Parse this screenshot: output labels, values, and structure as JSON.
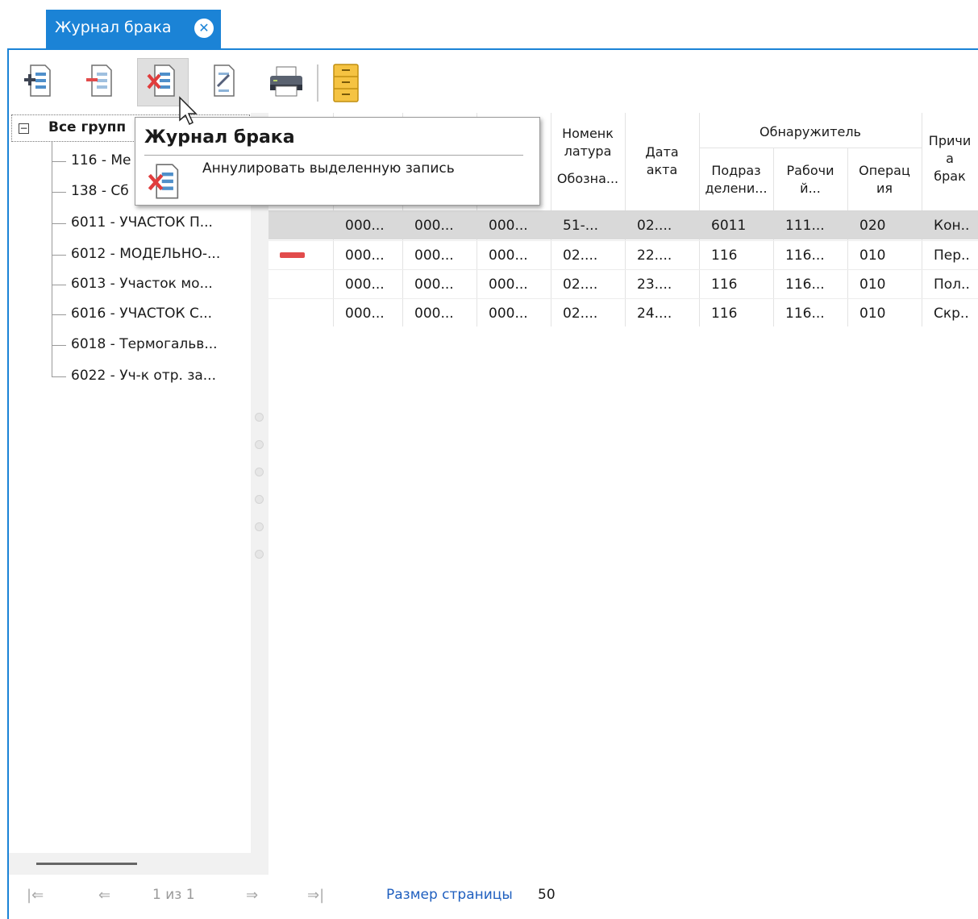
{
  "tab": {
    "title": "Журнал брака",
    "close_glyph": "✕"
  },
  "toolbar": {
    "buttons": [
      {
        "name": "add-record-icon"
      },
      {
        "name": "remove-record-icon"
      },
      {
        "name": "annul-record-icon",
        "pressed": true
      },
      {
        "name": "edit-record-icon"
      },
      {
        "name": "print-icon"
      },
      {
        "name": "archive-cabinet-icon"
      }
    ]
  },
  "tree": {
    "root_label": "Все групп",
    "expander": "−",
    "items": [
      {
        "label": "116 - Ме"
      },
      {
        "label": "138 - Сб"
      },
      {
        "label": "6011 - УЧАСТОК П..."
      },
      {
        "label": "6012 - МОДЕЛЬНО-..."
      },
      {
        "label": "6013 - Участок мо..."
      },
      {
        "label": "6016 - УЧАСТОК С..."
      },
      {
        "label": "6018 - Термогальв..."
      },
      {
        "label": "6022 - Уч-к отр. за..."
      }
    ]
  },
  "grid": {
    "headers": {
      "nomenclature_top": "Номенк",
      "nomenclature_mid": "латура",
      "nomenclature_bottom": "Обозна...",
      "date_top": "Дата",
      "date_bottom": "акта",
      "detector_group": "Обнаружитель",
      "dept_top": "Подраз",
      "dept_bottom": "делени...",
      "worker_top": "Рабочи",
      "worker_bottom": "й...",
      "operation_top": "Операц",
      "operation_bottom": "ия",
      "reason_top": "Причи",
      "reason_mid": "а",
      "reason_bottom": "брак"
    },
    "rows": [
      {
        "c1": "000...",
        "c2": "000...",
        "c3": "000...",
        "nomen": "51-...",
        "date": "02....",
        "dept": "6011",
        "worker": "111...",
        "op": "020",
        "reason": "Кон..",
        "marker": false
      },
      {
        "c1": "000...",
        "c2": "000...",
        "c3": "000...",
        "nomen": "02....",
        "date": "22....",
        "dept": "116",
        "worker": "116...",
        "op": "010",
        "reason": "Пер..",
        "marker": true
      },
      {
        "c1": "000...",
        "c2": "000...",
        "c3": "000...",
        "nomen": "02....",
        "date": "23....",
        "dept": "116",
        "worker": "116...",
        "op": "010",
        "reason": "Пол..",
        "marker": false
      },
      {
        "c1": "000...",
        "c2": "000...",
        "c3": "000...",
        "nomen": "02....",
        "date": "24....",
        "dept": "116",
        "worker": "116...",
        "op": "010",
        "reason": "Скр..",
        "marker": false
      }
    ],
    "marker_color": "#e24b4b"
  },
  "pager": {
    "first_glyph": "|⇐",
    "prev_glyph": "⇐",
    "page_text": "1 из 1",
    "next_glyph": "⇒",
    "last_glyph": "⇒|",
    "page_size_label": "Размер страницы",
    "page_size_value": "50"
  },
  "tooltip": {
    "title": "Журнал брака",
    "description": "Аннулировать выделенную запись"
  },
  "colors": {
    "accent": "#1b83d6",
    "link": "#1f5fbf",
    "selected_row": "#d9d9d9"
  }
}
